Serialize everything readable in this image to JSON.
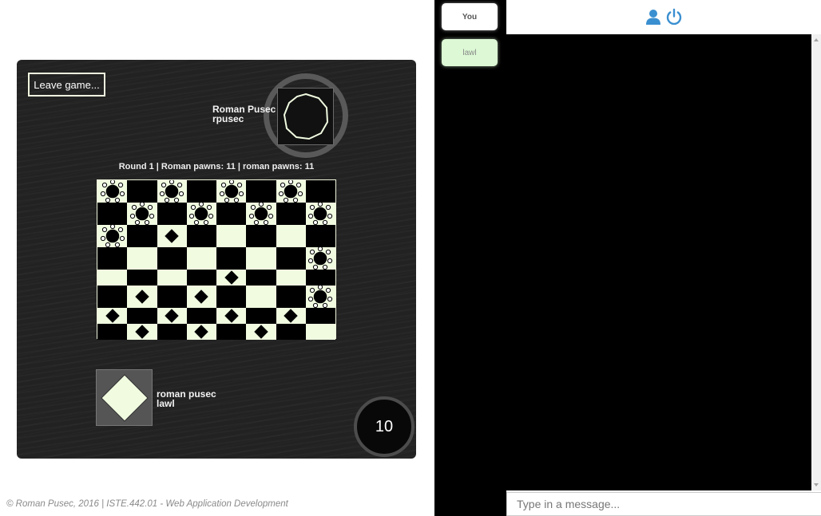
{
  "game": {
    "leave_label": "Leave game...",
    "opponent": {
      "name": "Roman Pusec",
      "username": "rpusec"
    },
    "self": {
      "name": "roman pusec",
      "username": "lawl"
    },
    "status": "Round 1 | Roman pawns: 11 | roman pawns: 11",
    "turn_timer": "10",
    "board": [
      [
        "o",
        ".",
        "o",
        ".",
        "o",
        ".",
        "o",
        "."
      ],
      [
        ".",
        "o",
        ".",
        "o",
        ".",
        "o",
        ".",
        "o"
      ],
      [
        "o",
        ".",
        "d",
        ".",
        ".",
        ".",
        ".",
        "."
      ],
      [
        ".",
        ".",
        ".",
        ".",
        ".",
        ".",
        ".",
        "o"
      ],
      [
        ".",
        ".",
        ".",
        ".",
        "d",
        ".",
        ".",
        "."
      ],
      [
        ".",
        "d",
        ".",
        "d",
        ".",
        ".",
        ".",
        "o"
      ],
      [
        "d",
        ".",
        "d",
        ".",
        "d",
        ".",
        "d",
        "."
      ],
      [
        ".",
        "d",
        ".",
        "d",
        ".",
        "d",
        ".",
        "."
      ]
    ]
  },
  "footer": "© Roman Pusec, 2016 | ISTE.442.01 - Web Application Development",
  "sidebar": {
    "players": [
      {
        "label": "You"
      },
      {
        "label": "lawl"
      }
    ]
  },
  "chat": {
    "placeholder": "Type in a message...",
    "icons": [
      "user-icon",
      "power-icon"
    ],
    "icon_color": "#3a8fd0"
  }
}
